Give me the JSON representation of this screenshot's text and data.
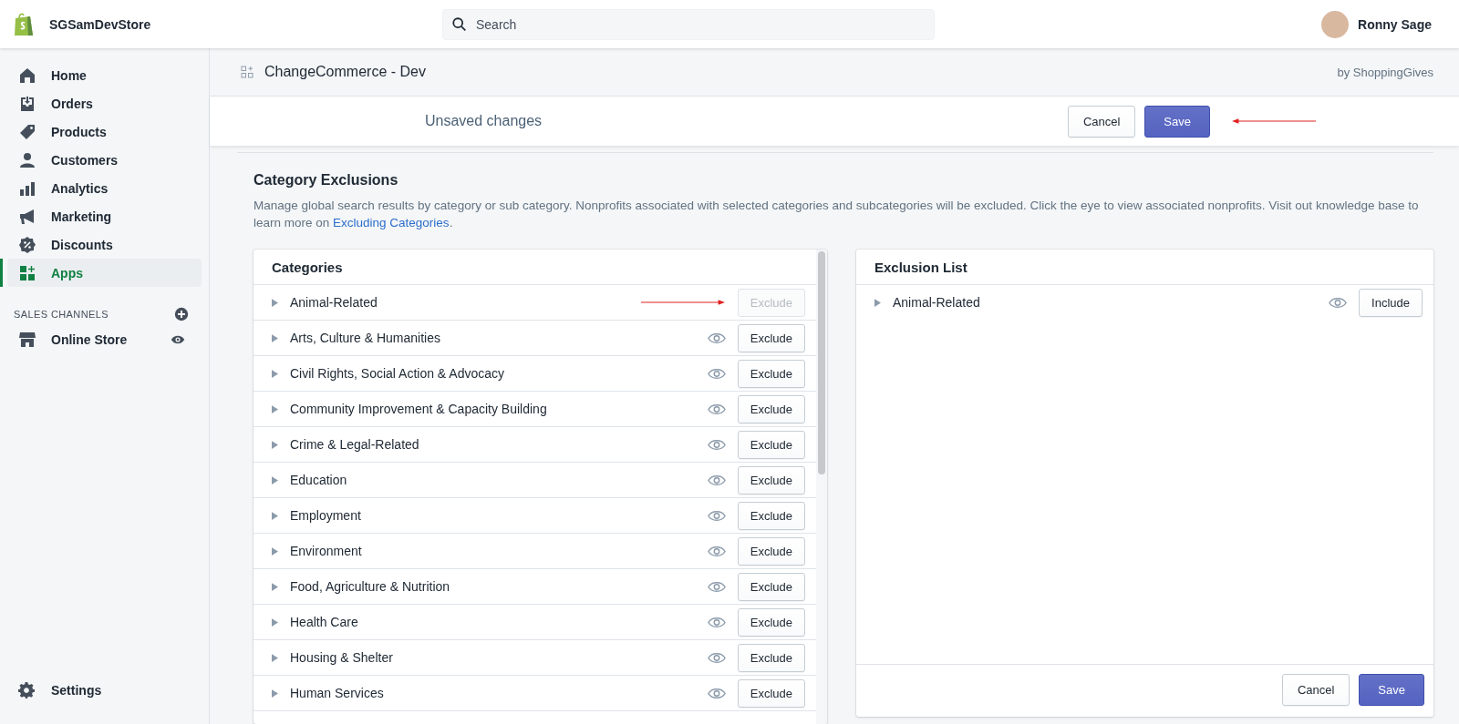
{
  "topbar": {
    "store_name": "SGSamDevStore",
    "search": {
      "placeholder": "Search"
    },
    "user_name": "Ronny Sage"
  },
  "sidebar": {
    "items": [
      {
        "label": "Home",
        "selected": false
      },
      {
        "label": "Orders",
        "selected": false
      },
      {
        "label": "Products",
        "selected": false
      },
      {
        "label": "Customers",
        "selected": false
      },
      {
        "label": "Analytics",
        "selected": false
      },
      {
        "label": "Marketing",
        "selected": false
      },
      {
        "label": "Discounts",
        "selected": false
      },
      {
        "label": "Apps",
        "selected": true
      }
    ],
    "sales_channels": {
      "heading": "SALES CHANNELS",
      "items": [
        {
          "label": "Online Store"
        }
      ]
    },
    "settings": "Settings"
  },
  "app_header": {
    "title": "ChangeCommerce - Dev",
    "byline": "by ShoppingGives"
  },
  "save_bar": {
    "message": "Unsaved changes",
    "cancel": "Cancel",
    "save": "Save"
  },
  "section": {
    "title": "Category Exclusions",
    "description": "Manage global search results by category or sub category. Nonprofits associated with selected categories and subcategories will be excluded. Click the eye to view associated nonprofits. Visit out knowledge base to learn more on ",
    "link": "Excluding Categories",
    "description_end": "."
  },
  "categories": {
    "title": "Categories",
    "rows": [
      {
        "name": "Animal-Related",
        "button": "Exclude",
        "disabled": true
      },
      {
        "name": "Arts, Culture & Humanities",
        "button": "Exclude",
        "disabled": false
      },
      {
        "name": "Civil Rights, Social Action & Advocacy",
        "button": "Exclude",
        "disabled": false
      },
      {
        "name": "Community Improvement & Capacity Building",
        "button": "Exclude",
        "disabled": false
      },
      {
        "name": "Crime & Legal-Related",
        "button": "Exclude",
        "disabled": false
      },
      {
        "name": "Education",
        "button": "Exclude",
        "disabled": false
      },
      {
        "name": "Employment",
        "button": "Exclude",
        "disabled": false
      },
      {
        "name": "Environment",
        "button": "Exclude",
        "disabled": false
      },
      {
        "name": "Food, Agriculture & Nutrition",
        "button": "Exclude",
        "disabled": false
      },
      {
        "name": "Health Care",
        "button": "Exclude",
        "disabled": false
      },
      {
        "name": "Housing & Shelter",
        "button": "Exclude",
        "disabled": false
      },
      {
        "name": "Human Services",
        "button": "Exclude",
        "disabled": false
      }
    ]
  },
  "exclusion_list": {
    "title": "Exclusion List",
    "rows": [
      {
        "name": "Animal-Related",
        "button": "Include"
      }
    ],
    "cancel": "Cancel",
    "save": "Save"
  }
}
